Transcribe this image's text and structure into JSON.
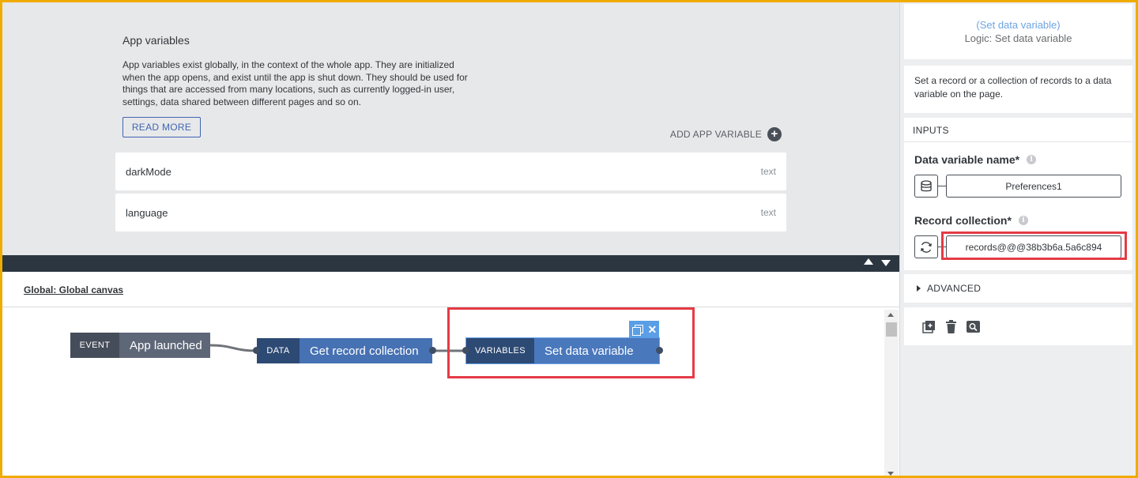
{
  "app_variables": {
    "title": "App variables",
    "description": "App variables exist globally, in the context of the whole app. They are initialized when the app opens, and exist until the app is shut down. They should be used for things that are accessed from many locations, such as currently logged-in user, settings, data shared between different pages and so on.",
    "read_more_label": "READ MORE",
    "add_label": "ADD APP VARIABLE",
    "items": [
      {
        "name": "darkMode",
        "type": "text"
      },
      {
        "name": "language",
        "type": "text"
      }
    ]
  },
  "canvas": {
    "link_label": "Global: Global canvas",
    "nodes": {
      "event": {
        "category": "EVENT",
        "label": "App launched"
      },
      "data": {
        "category": "DATA",
        "label": "Get record collection"
      },
      "variables": {
        "category": "VARIABLES",
        "label": "Set data variable"
      }
    }
  },
  "panel": {
    "header_link": "(Set data variable)",
    "header_sub": "Logic: Set data variable",
    "description": "Set a record or a collection of records to a data variable on the page.",
    "inputs_title": "INPUTS",
    "fields": [
      {
        "label": "Data variable name*",
        "value": "Preferences1",
        "icon": "database-icon"
      },
      {
        "label": "Record collection*",
        "value": "records@@@38b3b6a.5a6c894",
        "icon": "refresh-icon"
      }
    ],
    "advanced_label": "ADVANCED",
    "actions": [
      "add-icon",
      "trash-icon",
      "search-icon"
    ]
  },
  "colors": {
    "highlight": "#e53b46",
    "accent": "#3f65b0",
    "frame": "#f0ab00"
  }
}
